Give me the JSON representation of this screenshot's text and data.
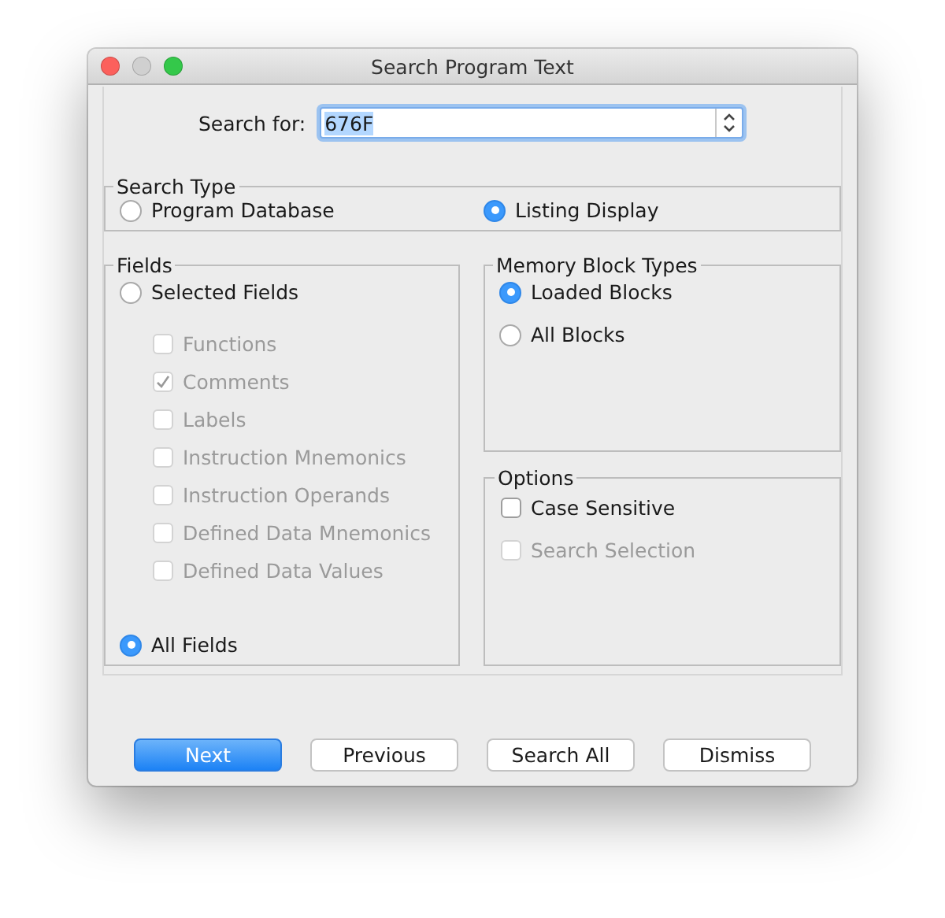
{
  "window": {
    "title": "Search Program Text"
  },
  "search": {
    "label": "Search for:",
    "value": "676F"
  },
  "search_type": {
    "title": "Search Type",
    "options": [
      {
        "label": "Program Database",
        "selected": false
      },
      {
        "label": "Listing Display",
        "selected": true
      }
    ]
  },
  "fields": {
    "title": "Fields",
    "selected_fields": {
      "label": "Selected Fields",
      "selected": false
    },
    "checkboxes": [
      {
        "label": "Functions",
        "checked": false,
        "disabled": true
      },
      {
        "label": "Comments",
        "checked": true,
        "disabled": true
      },
      {
        "label": "Labels",
        "checked": false,
        "disabled": true
      },
      {
        "label": "Instruction Mnemonics",
        "checked": false,
        "disabled": true
      },
      {
        "label": "Instruction Operands",
        "checked": false,
        "disabled": true
      },
      {
        "label": "Defined Data Mnemonics",
        "checked": false,
        "disabled": true
      },
      {
        "label": "Defined Data Values",
        "checked": false,
        "disabled": true
      }
    ],
    "all_fields": {
      "label": "All Fields",
      "selected": true
    }
  },
  "memory_block_types": {
    "title": "Memory Block Types",
    "options": [
      {
        "label": "Loaded Blocks",
        "selected": true
      },
      {
        "label": "All Blocks",
        "selected": false
      }
    ]
  },
  "options": {
    "title": "Options",
    "checkboxes": [
      {
        "label": "Case Sensitive",
        "checked": false,
        "disabled": false
      },
      {
        "label": "Search Selection",
        "checked": false,
        "disabled": true
      }
    ]
  },
  "buttons": [
    {
      "label": "Next",
      "default": true
    },
    {
      "label": "Previous",
      "default": false
    },
    {
      "label": "Search All",
      "default": false
    },
    {
      "label": "Dismiss",
      "default": false
    }
  ]
}
